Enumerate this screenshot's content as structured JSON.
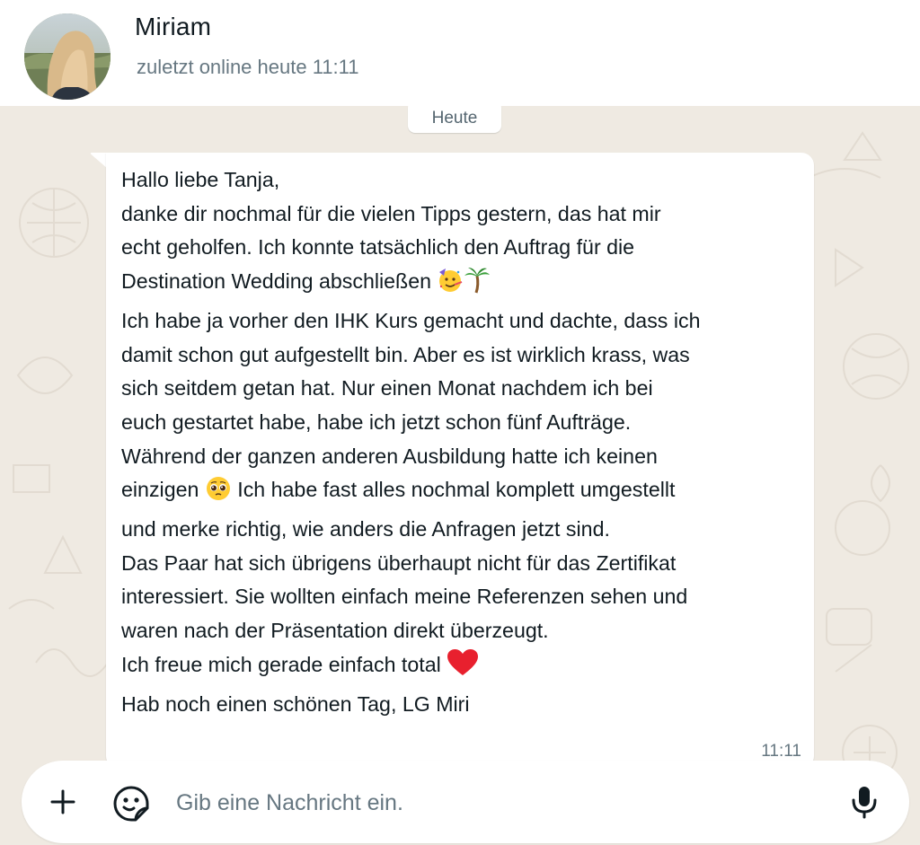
{
  "header": {
    "contact_name": "Miriam",
    "status": "zuletzt online heute 11:11"
  },
  "chat": {
    "date_chip": "Heute",
    "message": {
      "lines": [
        {
          "text": "Hallo liebe Tanja,"
        },
        {
          "text": "danke dir nochmal für die vielen Tipps gestern, das hat mir"
        },
        {
          "text": "echt geholfen. Ich konnte tatsächlich den Auftrag für die"
        },
        {
          "text": "Destination Wedding abschließen ",
          "emoji": [
            "partying-face",
            "palm-tree"
          ]
        },
        {
          "text": "Ich habe ja vorher den IHK Kurs gemacht und dachte, dass ich"
        },
        {
          "text": "damit schon gut aufgestellt bin. Aber es ist wirklich krass, was"
        },
        {
          "text": "sich seitdem getan hat. Nur einen Monat nachdem ich bei"
        },
        {
          "text": "euch gestartet habe, habe ich jetzt schon fünf Aufträge."
        },
        {
          "text": "Während der ganzen anderen Ausbildung hatte ich keinen"
        },
        {
          "text": "einzigen ",
          "emoji": [
            "pleading-face"
          ],
          "rest": " Ich habe fast alles nochmal komplett umgestellt"
        },
        {
          "text": "und merke richtig, wie anders die Anfragen jetzt sind."
        },
        {
          "text": "Das Paar hat sich übrigens überhaupt nicht für das Zertifikat"
        },
        {
          "text": "interessiert. Sie wollten einfach meine Referenzen sehen und"
        },
        {
          "text": "waren nach der Präsentation direkt überzeugt."
        },
        {
          "text": "Ich freue mich gerade einfach total ",
          "emoji": [
            "red-heart"
          ]
        },
        {
          "text": "Hab noch einen schönen Tag, LG Miri"
        }
      ],
      "time": "11:11"
    }
  },
  "composer": {
    "placeholder": "Gib eine Nachricht ein."
  },
  "colors": {
    "chat_background": "#efeae2",
    "bubble": "#ffffff",
    "primary_text": "#111b21",
    "secondary_text": "#667781"
  },
  "icons": [
    "plus-icon",
    "sticker-icon",
    "microphone-icon"
  ]
}
